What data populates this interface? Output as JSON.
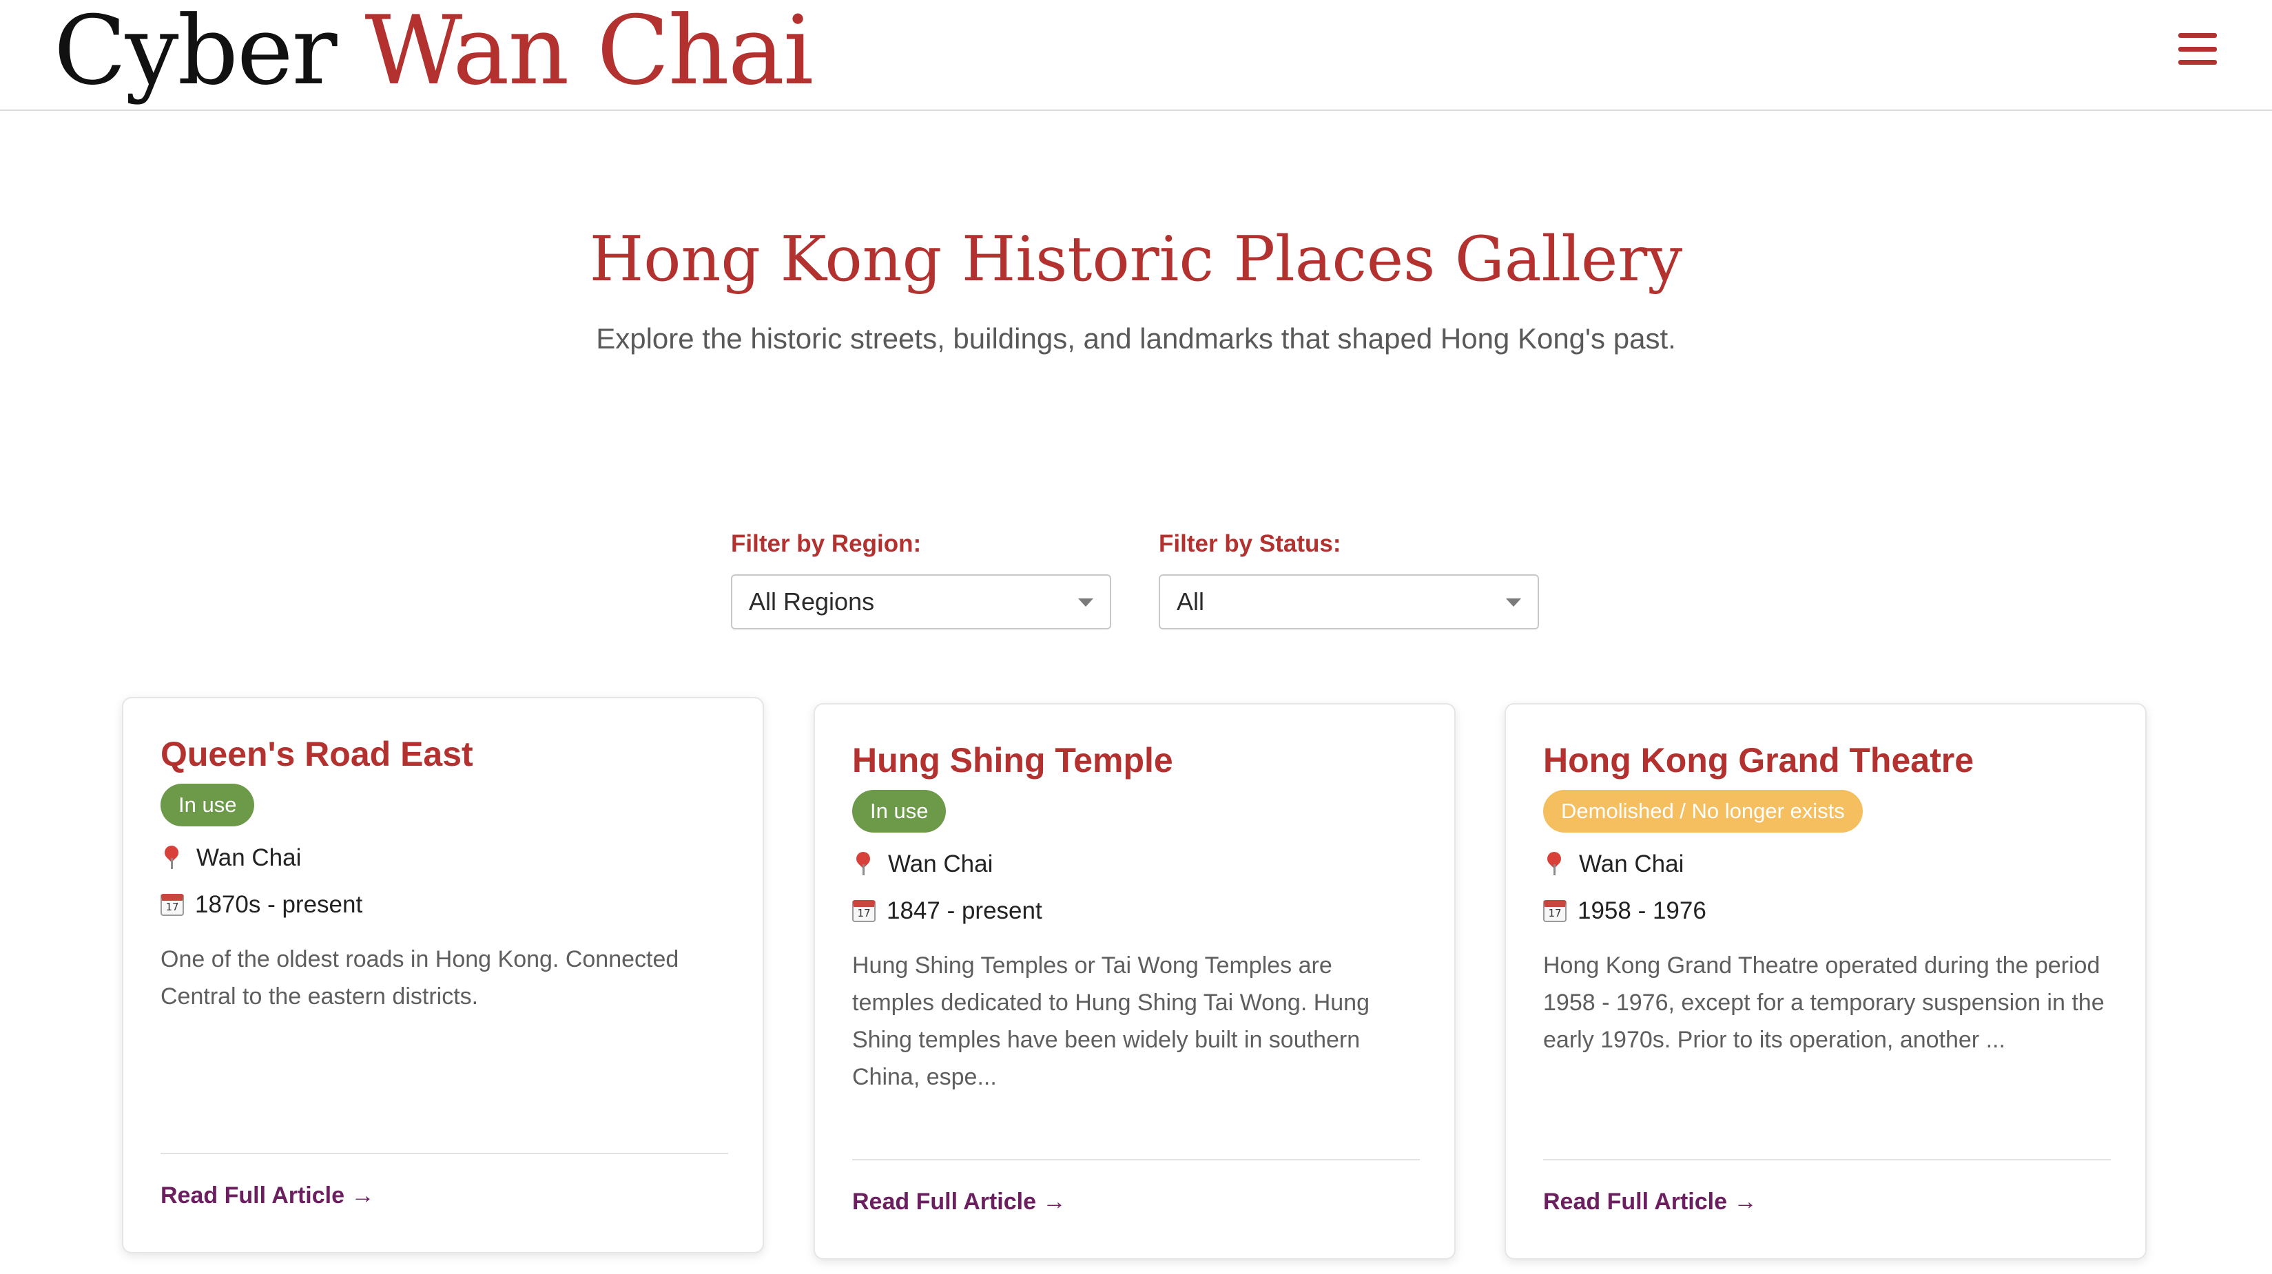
{
  "header": {
    "logo_part1": "Cyber",
    "logo_part2": "Wan Chai"
  },
  "hero": {
    "title": "Hong Kong Historic Places Gallery",
    "subtitle": "Explore the historic streets, buildings, and landmarks that shaped Hong Kong's past."
  },
  "filters": {
    "region": {
      "label": "Filter by Region:",
      "selected": "All Regions"
    },
    "status": {
      "label": "Filter by Status:",
      "selected": "All"
    }
  },
  "cards": [
    {
      "title": "Queen's Road East",
      "status": "In use",
      "status_color": "#6c9a49",
      "region": "Wan Chai",
      "period": "1870s - present",
      "description": "One of the oldest roads in Hong Kong. Connected Central to the eastern districts.",
      "link": "Read Full Article →"
    },
    {
      "title": "Hung Shing Temple",
      "status": "In use",
      "status_color": "#6c9a49",
      "region": "Wan Chai",
      "period": "1847 - present",
      "description": "Hung Shing Temples or Tai Wong Temples are temples dedicated to Hung Shing Tai Wong. Hung Shing temples have been widely built in southern China, espe...",
      "link": "Read Full Article →"
    },
    {
      "title": "Hong Kong Grand Theatre",
      "status": "Demolished / No longer exists",
      "status_color": "#f5be5e",
      "region": "Wan Chai",
      "period": "1958 - 1976",
      "description": "Hong Kong Grand Theatre operated during the period 1958 - 1976, except for a temporary suspension in the early 1970s. Prior to its operation, another ...",
      "link": "Read Full Article →"
    }
  ],
  "colors": {
    "accent": "#b3312f",
    "link": "#6b1f5f",
    "in_use": "#6c9a49",
    "demolished": "#f5be5e"
  }
}
